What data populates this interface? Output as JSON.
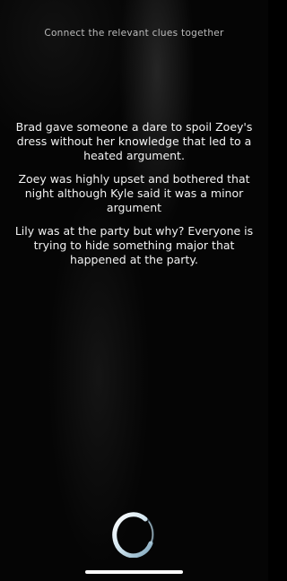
{
  "header": {
    "instruction": "Connect the relevant clues together"
  },
  "clues": [
    "Brad gave someone a dare to spoil Zoey's dress without her knowledge that led to a heated argument.",
    "Zoey was highly upset and bothered that night although Kyle said it was a minor argument",
    "Lily was at the party but why? Everyone is trying to hide something major that happened at the party."
  ],
  "icons": {
    "loader": "loading-ring-icon"
  },
  "colors": {
    "background": "#000000",
    "text": "#f2f2f2",
    "header_text": "#bdbdbd",
    "spinner_accent": "#8fb3c8"
  }
}
